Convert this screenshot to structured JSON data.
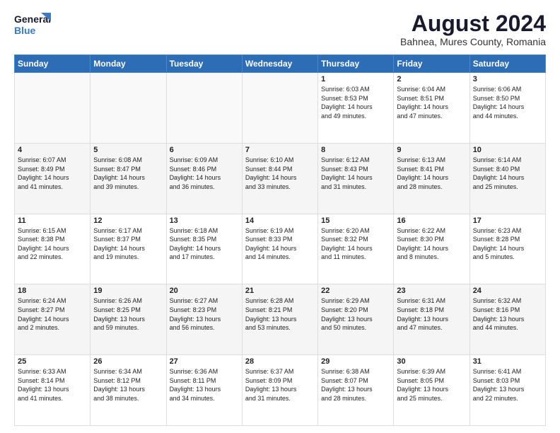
{
  "header": {
    "logo_line1": "General",
    "logo_line2": "Blue",
    "title": "August 2024",
    "subtitle": "Bahnea, Mures County, Romania"
  },
  "weekdays": [
    "Sunday",
    "Monday",
    "Tuesday",
    "Wednesday",
    "Thursday",
    "Friday",
    "Saturday"
  ],
  "weeks": [
    [
      {
        "day": "",
        "info": ""
      },
      {
        "day": "",
        "info": ""
      },
      {
        "day": "",
        "info": ""
      },
      {
        "day": "",
        "info": ""
      },
      {
        "day": "1",
        "info": "Sunrise: 6:03 AM\nSunset: 8:53 PM\nDaylight: 14 hours\nand 49 minutes."
      },
      {
        "day": "2",
        "info": "Sunrise: 6:04 AM\nSunset: 8:51 PM\nDaylight: 14 hours\nand 47 minutes."
      },
      {
        "day": "3",
        "info": "Sunrise: 6:06 AM\nSunset: 8:50 PM\nDaylight: 14 hours\nand 44 minutes."
      }
    ],
    [
      {
        "day": "4",
        "info": "Sunrise: 6:07 AM\nSunset: 8:49 PM\nDaylight: 14 hours\nand 41 minutes."
      },
      {
        "day": "5",
        "info": "Sunrise: 6:08 AM\nSunset: 8:47 PM\nDaylight: 14 hours\nand 39 minutes."
      },
      {
        "day": "6",
        "info": "Sunrise: 6:09 AM\nSunset: 8:46 PM\nDaylight: 14 hours\nand 36 minutes."
      },
      {
        "day": "7",
        "info": "Sunrise: 6:10 AM\nSunset: 8:44 PM\nDaylight: 14 hours\nand 33 minutes."
      },
      {
        "day": "8",
        "info": "Sunrise: 6:12 AM\nSunset: 8:43 PM\nDaylight: 14 hours\nand 31 minutes."
      },
      {
        "day": "9",
        "info": "Sunrise: 6:13 AM\nSunset: 8:41 PM\nDaylight: 14 hours\nand 28 minutes."
      },
      {
        "day": "10",
        "info": "Sunrise: 6:14 AM\nSunset: 8:40 PM\nDaylight: 14 hours\nand 25 minutes."
      }
    ],
    [
      {
        "day": "11",
        "info": "Sunrise: 6:15 AM\nSunset: 8:38 PM\nDaylight: 14 hours\nand 22 minutes."
      },
      {
        "day": "12",
        "info": "Sunrise: 6:17 AM\nSunset: 8:37 PM\nDaylight: 14 hours\nand 19 minutes."
      },
      {
        "day": "13",
        "info": "Sunrise: 6:18 AM\nSunset: 8:35 PM\nDaylight: 14 hours\nand 17 minutes."
      },
      {
        "day": "14",
        "info": "Sunrise: 6:19 AM\nSunset: 8:33 PM\nDaylight: 14 hours\nand 14 minutes."
      },
      {
        "day": "15",
        "info": "Sunrise: 6:20 AM\nSunset: 8:32 PM\nDaylight: 14 hours\nand 11 minutes."
      },
      {
        "day": "16",
        "info": "Sunrise: 6:22 AM\nSunset: 8:30 PM\nDaylight: 14 hours\nand 8 minutes."
      },
      {
        "day": "17",
        "info": "Sunrise: 6:23 AM\nSunset: 8:28 PM\nDaylight: 14 hours\nand 5 minutes."
      }
    ],
    [
      {
        "day": "18",
        "info": "Sunrise: 6:24 AM\nSunset: 8:27 PM\nDaylight: 14 hours\nand 2 minutes."
      },
      {
        "day": "19",
        "info": "Sunrise: 6:26 AM\nSunset: 8:25 PM\nDaylight: 13 hours\nand 59 minutes."
      },
      {
        "day": "20",
        "info": "Sunrise: 6:27 AM\nSunset: 8:23 PM\nDaylight: 13 hours\nand 56 minutes."
      },
      {
        "day": "21",
        "info": "Sunrise: 6:28 AM\nSunset: 8:21 PM\nDaylight: 13 hours\nand 53 minutes."
      },
      {
        "day": "22",
        "info": "Sunrise: 6:29 AM\nSunset: 8:20 PM\nDaylight: 13 hours\nand 50 minutes."
      },
      {
        "day": "23",
        "info": "Sunrise: 6:31 AM\nSunset: 8:18 PM\nDaylight: 13 hours\nand 47 minutes."
      },
      {
        "day": "24",
        "info": "Sunrise: 6:32 AM\nSunset: 8:16 PM\nDaylight: 13 hours\nand 44 minutes."
      }
    ],
    [
      {
        "day": "25",
        "info": "Sunrise: 6:33 AM\nSunset: 8:14 PM\nDaylight: 13 hours\nand 41 minutes."
      },
      {
        "day": "26",
        "info": "Sunrise: 6:34 AM\nSunset: 8:12 PM\nDaylight: 13 hours\nand 38 minutes."
      },
      {
        "day": "27",
        "info": "Sunrise: 6:36 AM\nSunset: 8:11 PM\nDaylight: 13 hours\nand 34 minutes."
      },
      {
        "day": "28",
        "info": "Sunrise: 6:37 AM\nSunset: 8:09 PM\nDaylight: 13 hours\nand 31 minutes."
      },
      {
        "day": "29",
        "info": "Sunrise: 6:38 AM\nSunset: 8:07 PM\nDaylight: 13 hours\nand 28 minutes."
      },
      {
        "day": "30",
        "info": "Sunrise: 6:39 AM\nSunset: 8:05 PM\nDaylight: 13 hours\nand 25 minutes."
      },
      {
        "day": "31",
        "info": "Sunrise: 6:41 AM\nSunset: 8:03 PM\nDaylight: 13 hours\nand 22 minutes."
      }
    ]
  ]
}
